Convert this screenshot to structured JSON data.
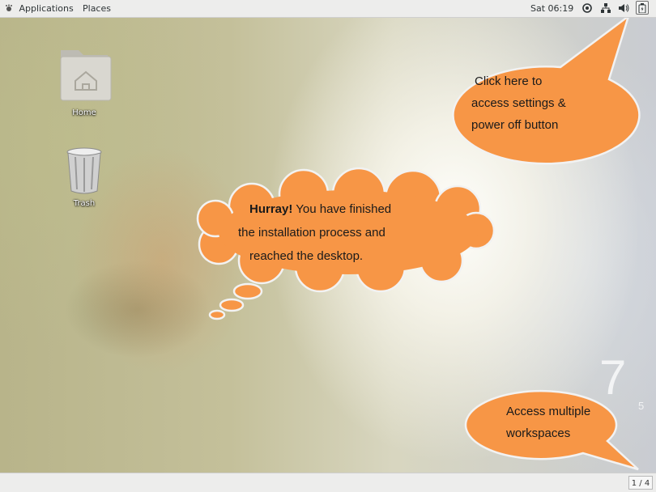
{
  "top_bar": {
    "applications_label": "Applications",
    "places_label": "Places",
    "clock": "Sat 06:19",
    "icons": [
      "accessibility-icon",
      "network-icon",
      "volume-icon",
      "battery-icon"
    ]
  },
  "desktop": {
    "icons": [
      {
        "label": "Home",
        "icon": "home-folder-icon"
      },
      {
        "label": "Trash",
        "icon": "trash-icon"
      }
    ],
    "watermark_partial": "7",
    "watermark_partial2": "5"
  },
  "callouts": {
    "settings": [
      "Click here to",
      "access settings &",
      "power off button"
    ],
    "cloud_bold": "Hurray!",
    "cloud_rest": " You have finished",
    "cloud_line2": "the installation  process and",
    "cloud_line3": "reached the desktop.",
    "workspaces": [
      "Access multiple",
      "workspaces"
    ]
  },
  "bottom_bar": {
    "workspace_indicator": "1 / 4"
  },
  "colors": {
    "callout_fill": "#f79646",
    "callout_stroke": "#f2f2f2",
    "panel_bg": "#ededec"
  }
}
